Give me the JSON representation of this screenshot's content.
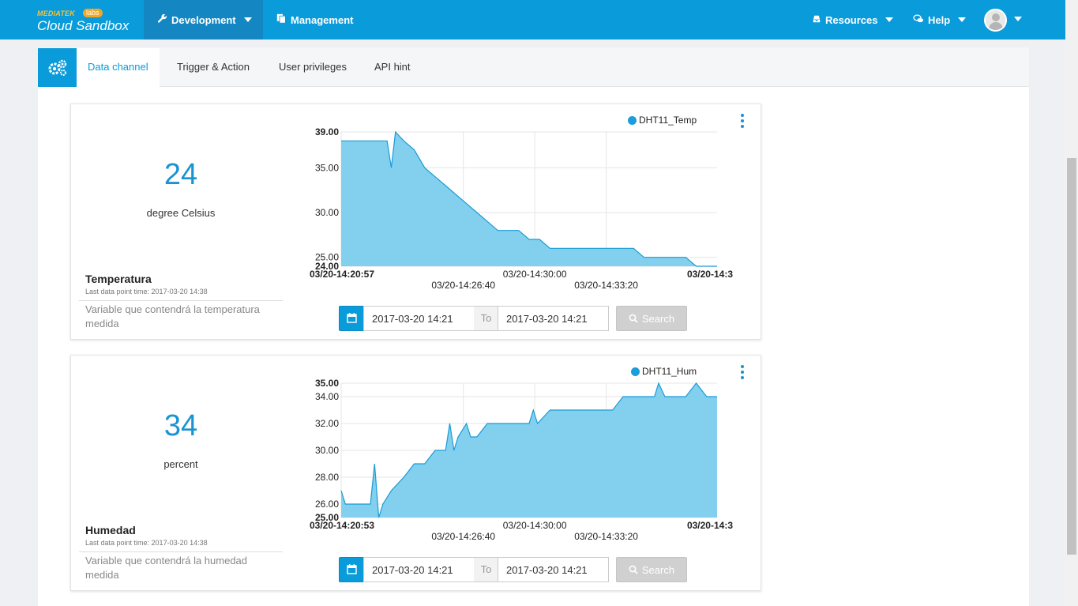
{
  "header": {
    "logo_brand": "MEDIATEK",
    "logo_labs": "labs",
    "logo_name": "Cloud Sandbox",
    "nav": {
      "development": "Development",
      "management": "Management",
      "resources": "Resources",
      "help": "Help"
    }
  },
  "tabs": {
    "data_channel": "Data channel",
    "trigger_action": "Trigger & Action",
    "user_privileges": "User privileges",
    "api_hint": "API hint"
  },
  "channels": [
    {
      "value": "24",
      "unit": "degree Celsius",
      "name": "Temperatura",
      "last_time": "Last data point time: 2017-03-20 14:38",
      "description": "Variable que contendrá la temperatura medida",
      "legend": "DHT11_Temp",
      "from_date": "2017-03-20 14:21",
      "to_label": "To",
      "to_date": "2017-03-20 14:21",
      "search_label": "Search"
    },
    {
      "value": "34",
      "unit": "percent",
      "name": "Humedad",
      "last_time": "Last data point time: 2017-03-20 14:38",
      "description": "Variable que contendrá la humedad medida",
      "legend": "DHT11_Hum",
      "from_date": "2017-03-20 14:21",
      "to_label": "To",
      "to_date": "2017-03-20 14:21",
      "search_label": "Search"
    }
  ],
  "colors": {
    "accent": "#0a9bdb",
    "area_fill": "#82d0ee",
    "area_line": "#1a9bd5"
  },
  "chart_data": [
    {
      "type": "area",
      "series": [
        {
          "name": "DHT11_Temp",
          "x_minutes": [
            0,
            0.5,
            1,
            1.5,
            2,
            2.2,
            2.4,
            2.6,
            3,
            3.5,
            4,
            4.5,
            5,
            5.5,
            6,
            6.5,
            7,
            7.5,
            8,
            8.5,
            9,
            9.5,
            10,
            10.5,
            11,
            11.5,
            12,
            12.5,
            13,
            13.5,
            14,
            14.5,
            15,
            15.5,
            16,
            16.5,
            17,
            17.5,
            18
          ],
          "values": [
            38,
            38,
            38,
            38,
            38,
            38,
            35,
            39,
            38,
            37,
            35,
            34,
            33,
            32,
            31,
            30,
            29,
            28,
            28,
            28,
            27,
            27,
            26,
            26,
            26,
            26,
            26,
            26,
            26,
            26,
            26,
            25,
            25,
            25,
            25,
            25,
            24,
            24,
            24
          ]
        }
      ],
      "yticks": [
        "39.00",
        "35.00",
        "30.00",
        "25.00",
        "24.00"
      ],
      "xticks_row1": [
        "03/20-14:20:57",
        "03/20-14:30:00",
        "03/20-14:3"
      ],
      "xticks_row2": [
        "03/20-14:26:40",
        "03/20-14:33:20"
      ],
      "ylim": [
        24,
        39
      ],
      "grid": true
    },
    {
      "type": "area",
      "series": [
        {
          "name": "DHT11_Hum",
          "x_minutes": [
            0,
            0.2,
            0.4,
            1,
            1.4,
            1.6,
            1.8,
            2,
            2.4,
            3,
            3.5,
            4,
            4.5,
            5,
            5.2,
            5.4,
            5.6,
            6,
            6.2,
            6.5,
            7,
            7.5,
            8,
            9,
            9.2,
            9.4,
            10,
            10.5,
            11,
            11.5,
            12,
            12.5,
            13,
            13.5,
            14,
            14.5,
            15,
            15.2,
            15.5,
            16,
            16.5,
            17,
            17.5,
            18
          ],
          "values": [
            27,
            26,
            26,
            26,
            26,
            29,
            25,
            26,
            27,
            28,
            29,
            29,
            30,
            30,
            32,
            30,
            31,
            32,
            31,
            31,
            32,
            32,
            32,
            32,
            33,
            32,
            33,
            33,
            33,
            33,
            33,
            33,
            33,
            34,
            34,
            34,
            34,
            35,
            34,
            34,
            34,
            35,
            34,
            34
          ]
        }
      ],
      "yticks": [
        "35.00",
        "34.00",
        "32.00",
        "30.00",
        "28.00",
        "26.00",
        "25.00"
      ],
      "xticks_row1": [
        "03/20-14:20:53",
        "03/20-14:30:00",
        "03/20-14:3"
      ],
      "xticks_row2": [
        "03/20-14:26:40",
        "03/20-14:33:20"
      ],
      "ylim": [
        25,
        35
      ],
      "grid": true
    }
  ]
}
